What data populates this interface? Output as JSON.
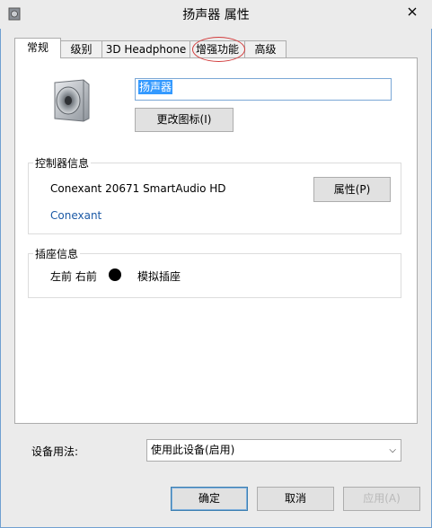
{
  "window": {
    "title": "扬声器 属性"
  },
  "tabs": [
    {
      "label": "常规",
      "active": true
    },
    {
      "label": "级别"
    },
    {
      "label": "3D Headphone"
    },
    {
      "label": "增强功能"
    },
    {
      "label": "高级"
    }
  ],
  "general": {
    "device_name": "扬声器",
    "change_icon_label": "更改图标(I)",
    "controller": {
      "group_label": "控制器信息",
      "name": "Conexant 20671 SmartAudio HD",
      "link": "Conexant",
      "properties_label": "属性(P)"
    },
    "jack": {
      "group_label": "插座信息",
      "position": "左前 右前",
      "type": "模拟插座"
    },
    "usage": {
      "label": "设备用法:",
      "selected": "使用此设备(启用)"
    }
  },
  "buttons": {
    "ok": "确定",
    "cancel": "取消",
    "apply": "应用(A)"
  },
  "icons": {
    "app": "speaker-icon",
    "close": "close-icon",
    "device": "speaker-icon",
    "dropdown": "chevron-down-icon"
  },
  "colors": {
    "highlight": "#3399ff",
    "link": "#1c5aa6",
    "annotation": "#d23c3c"
  }
}
